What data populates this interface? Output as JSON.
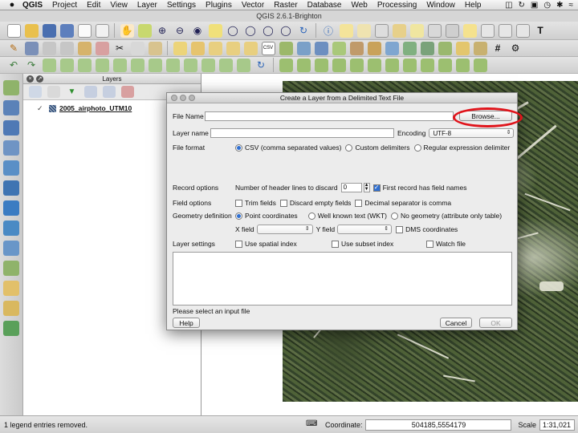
{
  "menubar": {
    "apple": "",
    "app": "QGIS",
    "items": [
      "Project",
      "Edit",
      "View",
      "Layer",
      "Settings",
      "Plugins",
      "Vector",
      "Raster",
      "Database",
      "Web",
      "Processing",
      "Window",
      "Help"
    ]
  },
  "window": {
    "title": "QGIS 2.6.1-Brighton"
  },
  "layers_panel": {
    "title": "Layers",
    "layer_name": "2005_airphoto_UTM10"
  },
  "dialog": {
    "title": "Create a Layer from a Delimited Text File",
    "file_name_label": "File Name",
    "file_name_value": "",
    "browse_label": "Browse...",
    "layer_name_label": "Layer name",
    "layer_name_value": "",
    "encoding_label": "Encoding",
    "encoding_value": "UTF-8",
    "file_format_label": "File format",
    "format_csv": "CSV (comma separated values)",
    "format_custom": "Custom delimiters",
    "format_regex": "Regular expression delimiter",
    "record_options_label": "Record options",
    "header_lines_label": "Number of header lines to discard",
    "header_lines_value": "0",
    "first_record_label": "First record has field names",
    "field_options_label": "Field options",
    "trim_fields": "Trim fields",
    "discard_empty": "Discard empty fields",
    "decimal_comma": "Decimal separator is comma",
    "geometry_label": "Geometry definition",
    "geom_point": "Point coordinates",
    "geom_wkt": "Well known text (WKT)",
    "geom_none": "No geometry (attribute only table)",
    "x_field_label": "X field",
    "y_field_label": "Y field",
    "dms_label": "DMS coordinates",
    "layer_settings_label": "Layer settings",
    "spatial_index": "Use spatial index",
    "subset_index": "Use subset index",
    "watch_file": "Watch file",
    "status_message": "Please select an input file",
    "help_label": "Help",
    "cancel_label": "Cancel",
    "ok_label": "OK"
  },
  "statusbar": {
    "message": "1 legend entries removed.",
    "coordinate_label": "Coordinate:",
    "coordinate_value": "504185,5554179",
    "scale_label": "Scale",
    "scale_value": "1:31,021"
  },
  "colors": {
    "highlight_ring": "#e0141b",
    "accent": "#2f6fd1"
  }
}
